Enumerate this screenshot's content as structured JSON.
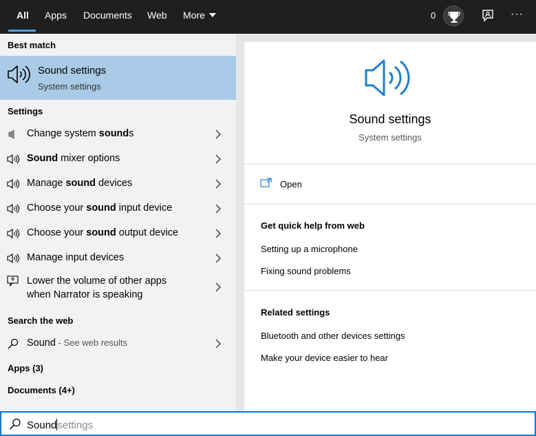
{
  "tabs": [
    {
      "label": "All",
      "active": true
    },
    {
      "label": "Apps"
    },
    {
      "label": "Documents"
    },
    {
      "label": "Web"
    },
    {
      "label": "More"
    }
  ],
  "topbar": {
    "points": "0",
    "more_dots": "···"
  },
  "left": {
    "best_match_header": "Best match",
    "best_match": {
      "title": "Sound settings",
      "subtitle": "System settings",
      "icon": "speaker-icon"
    },
    "settings_header": "Settings",
    "settings": [
      {
        "pre": "Change system ",
        "bold": "sound",
        "post": "s",
        "icon": "speaker-small-icon"
      },
      {
        "pre": "",
        "bold": "Sound",
        "post": " mixer options",
        "icon": "speaker-icon"
      },
      {
        "pre": "Manage ",
        "bold": "sound",
        "post": " devices",
        "icon": "speaker-icon"
      },
      {
        "pre": "Choose your ",
        "bold": "sound",
        "post": " input device",
        "icon": "speaker-icon"
      },
      {
        "pre": "Choose your ",
        "bold": "sound",
        "post": " output device",
        "icon": "speaker-icon"
      },
      {
        "pre": "Manage input devices",
        "bold": "",
        "post": "",
        "icon": "speaker-icon"
      }
    ],
    "narrator": {
      "line1": "Lower the volume of other apps",
      "line2": "when Narrator is speaking",
      "icon": "narrator-icon"
    },
    "web_header": "Search the web",
    "web_result": {
      "label": "Sound",
      "suffix": " - See web results",
      "icon": "search-icon"
    },
    "apps_header": "Apps (3)",
    "documents_header": "Documents (4+)"
  },
  "right": {
    "title": "Sound settings",
    "subtitle": "System settings",
    "open_label": "Open",
    "help_header": "Get quick help from web",
    "help_links": [
      "Setting up a microphone",
      "Fixing sound problems"
    ],
    "related_header": "Related settings",
    "related_links": [
      "Bluetooth and other devices settings",
      "Make your device easier to hear"
    ]
  },
  "search": {
    "typed": "Sound",
    "suggestion": "settings"
  },
  "colors": {
    "accent": "#0078d7",
    "selected": "#aacbe8",
    "icon_blue": "#1a7fd4"
  }
}
